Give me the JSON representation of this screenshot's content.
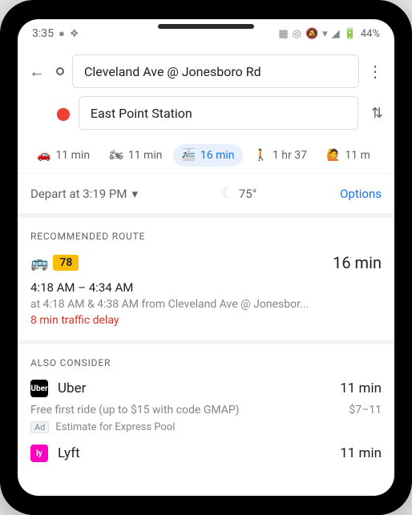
{
  "statusbar": {
    "time": "3:35",
    "battery": "44%"
  },
  "header": {
    "origin": "Cleveland Ave @ Jonesboro Rd",
    "destination": "East Point Station"
  },
  "modes": {
    "car": "11 min",
    "moto": "11 min",
    "transit": "16 min",
    "walk": "1 hr 37",
    "rideshare": "11 m"
  },
  "controls": {
    "depart": "Depart at 3:19 PM",
    "temp": "75°",
    "options": "Options"
  },
  "recommended": {
    "label": "RECOMMENDED ROUTE",
    "route_number": "78",
    "duration": "16 min",
    "times": "4:18 AM – 4:34 AM",
    "detail": "at 4:18 AM & 4:38 AM from Cleveland Ave @ Jonesbor...",
    "delay": "8 min traffic delay"
  },
  "also": {
    "label": "ALSO CONSIDER",
    "uber": {
      "name": "Uber",
      "duration": "11 min",
      "promo": "Free first ride (up to $15 with code GMAP)",
      "price": "$7–11",
      "ad_label": "Ad",
      "estimate": "Estimate for Express Pool"
    },
    "lyft": {
      "name": "Lyft",
      "duration": "11 min"
    }
  }
}
